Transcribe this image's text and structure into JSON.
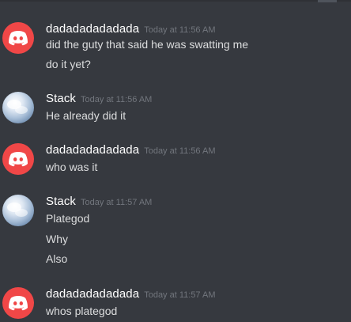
{
  "messages": [
    {
      "avatar": "discord-logo-icon",
      "username": "dadadadadadada",
      "timestamp": "Today at 11:56 AM",
      "lines": [
        "did the guty that said he was swatting me",
        "do it yet?"
      ]
    },
    {
      "avatar": "sky-avatar",
      "username": "Stack",
      "timestamp": "Today at 11:56 AM",
      "lines": [
        "He already did it"
      ]
    },
    {
      "avatar": "discord-logo-icon",
      "username": "dadadadadadada",
      "timestamp": "Today at 11:56 AM",
      "lines": [
        "who was it"
      ]
    },
    {
      "avatar": "sky-avatar",
      "username": "Stack",
      "timestamp": "Today at 11:57 AM",
      "lines": [
        "Plategod",
        "Why",
        "Also"
      ]
    },
    {
      "avatar": "discord-logo-icon",
      "username": "dadadadadadada",
      "timestamp": "Today at 11:57 AM",
      "lines": [
        "whos plategod"
      ]
    }
  ],
  "colors": {
    "background": "#36393f",
    "username": "#ffffff",
    "timestamp": "#72767d",
    "message_text": "#dcddde",
    "discord_avatar": "#f04747"
  }
}
